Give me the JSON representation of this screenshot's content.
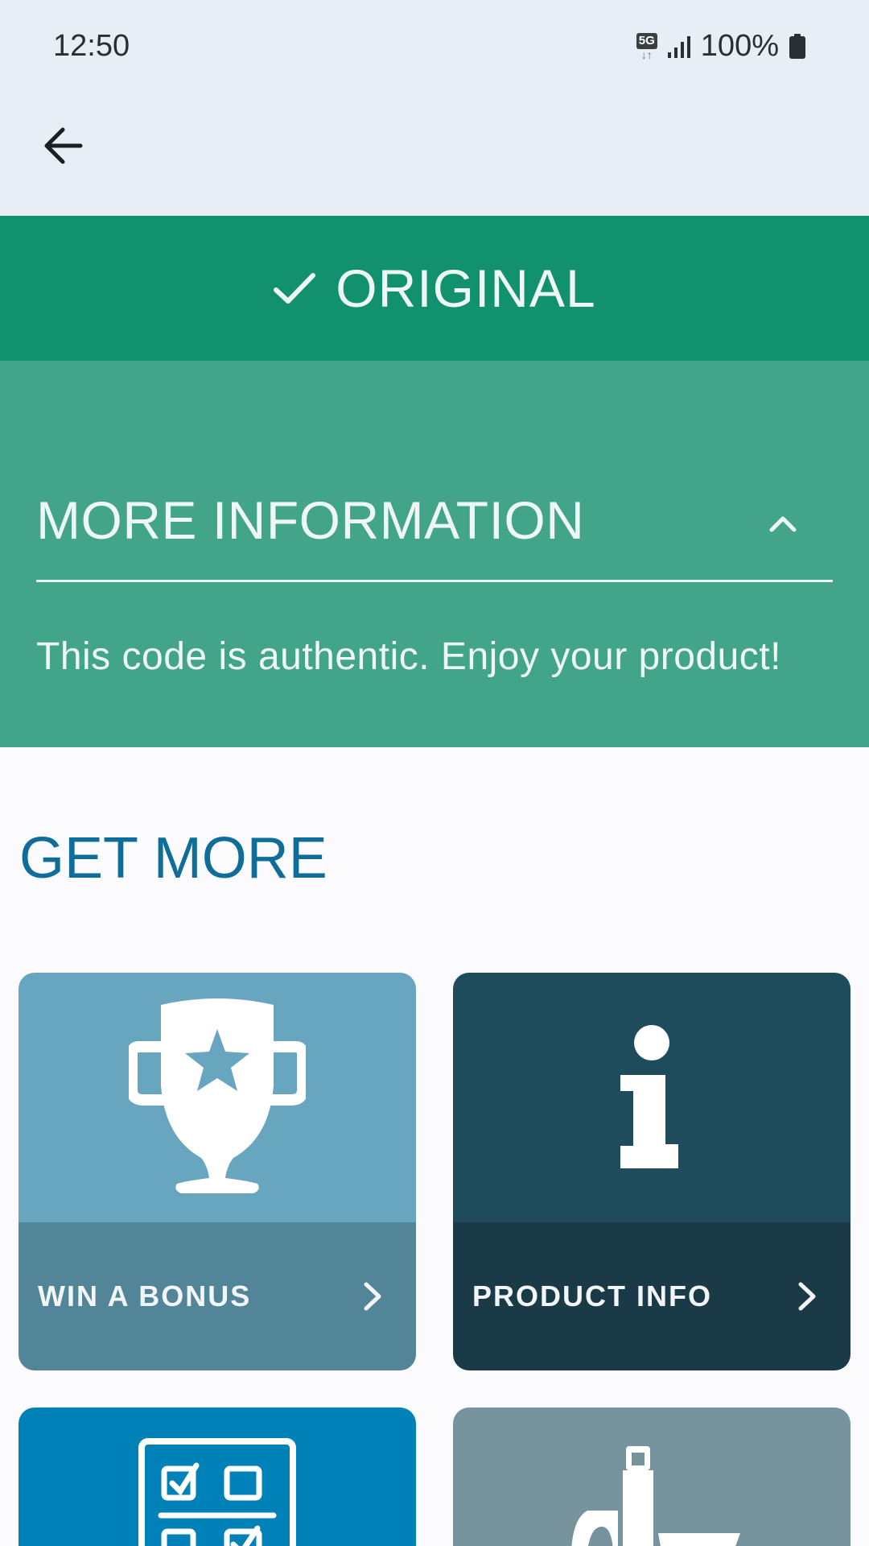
{
  "status_bar": {
    "time": "12:50",
    "network": "5G",
    "battery": "100%"
  },
  "banner": {
    "label": "ORIGINAL"
  },
  "info_panel": {
    "title": "MORE INFORMATION",
    "message": "This code is authentic. Enjoy your product!"
  },
  "section": {
    "title": "GET MORE"
  },
  "cards": [
    {
      "label": "WIN A BONUS",
      "icon": "trophy-icon",
      "color": "#67a6be"
    },
    {
      "label": "PRODUCT INFO",
      "icon": "info-icon",
      "color": "#1e4c5d"
    },
    {
      "label": "",
      "icon": "survey-icon",
      "color": "#0082b9"
    },
    {
      "label": "",
      "icon": "products-icon",
      "color": "#77939e"
    }
  ],
  "colors": {
    "banner_green": "#12916f",
    "panel_green": "#42a58a",
    "title_blue": "#0f6e99"
  }
}
